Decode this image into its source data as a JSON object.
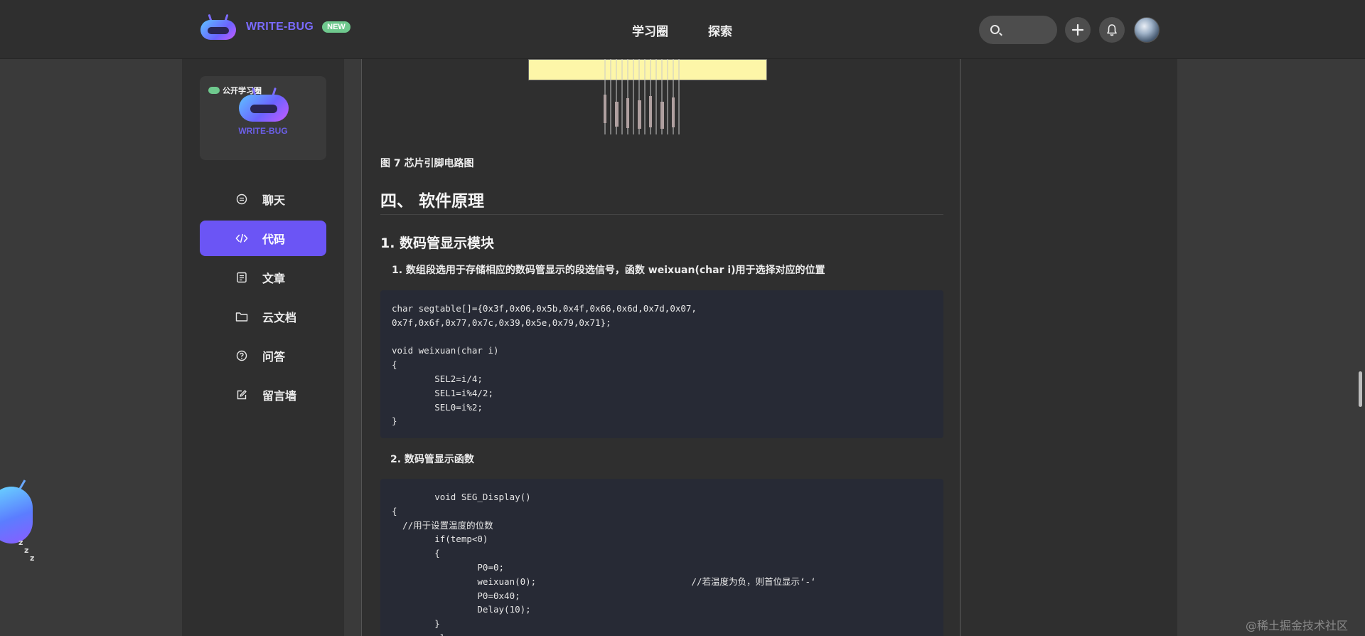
{
  "header": {
    "brand": "WRITE-BUG",
    "badge": "NEW",
    "nav": [
      "学习圈",
      "探索"
    ]
  },
  "sidebar": {
    "circle_card": {
      "tag": "公开学习圈",
      "brand": "WRITE-BUG"
    },
    "items": [
      {
        "label": "聊天",
        "icon": "chat-icon"
      },
      {
        "label": "代码",
        "icon": "code-icon",
        "active": true
      },
      {
        "label": "文章",
        "icon": "article-icon"
      },
      {
        "label": "云文档",
        "icon": "folder-icon"
      },
      {
        "label": "问答",
        "icon": "question-icon"
      },
      {
        "label": "留言墙",
        "icon": "edit-icon"
      }
    ]
  },
  "article": {
    "figure_caption": "图 7 芯片引脚电路图",
    "section_heading": "四、 软件原理",
    "subsection_heading": "1. 数码管显示模块",
    "point1": "1. 数组段选用于存储相应的数码管显示的段选信号，函数 weixuan(char i)用于选择对应的位置",
    "code1": "char segtable[]={0x3f,0x06,0x5b,0x4f,0x66,0x6d,0x7d,0x07,\n0x7f,0x6f,0x77,0x7c,0x39,0x5e,0x79,0x71};\n\nvoid weixuan(char i)\n{\n        SEL2=i/4;\n        SEL1=i%4/2;\n        SEL0=i%2;\n}",
    "point2": "2. 数码管显示函数",
    "code2": "        void SEG_Display()\n{\n  //用于设置温度的位数\n        if(temp<0)\n        {\n                P0=0;\n                weixuan(0);                             //若温度为负，则首位显示‘-‘\n                P0=0x40;\n                Delay(10);\n        }\n        else"
  },
  "mascot": {
    "z": [
      "z",
      "z",
      "z"
    ]
  },
  "watermark": "@稀土掘金技术社区",
  "colors": {
    "accent": "#6b55f5",
    "brand": "#7a6bff",
    "badge": "#6fc98e",
    "code_bg": "#272a35"
  }
}
